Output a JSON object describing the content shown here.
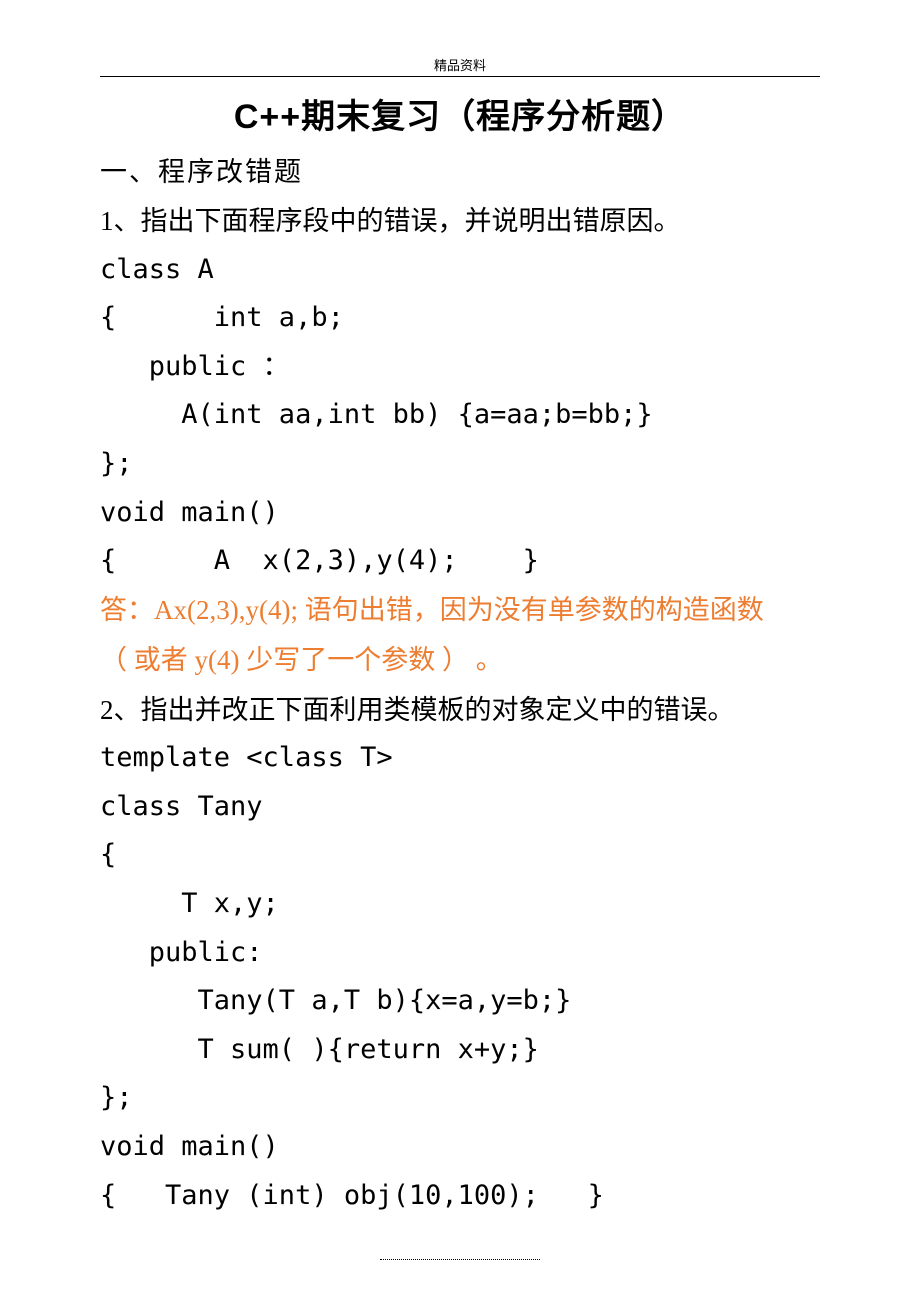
{
  "header": {
    "label": "精品资料"
  },
  "title": "C++期末复习（程序分析题）",
  "sectionHeading": "一、程序改错题",
  "q1": {
    "prompt": "1、指出下面程序段中的错误，并说明出错原因。",
    "code": {
      "l1": "class A",
      "l2": "{      int a,b;",
      "l3": "   public ：",
      "l4": "     A(int aa,int bb) {a=aa;b=bb;}",
      "l5": "};",
      "l6": "void main()",
      "l7": "{      A  x(2,3),y(4);    }"
    },
    "answer": {
      "l1": "答：Ax(2,3),y(4); 语句出错，因为没有单参数的构造函数",
      "l2": "（ 或者 y(4) 少写了一个参数 ） 。"
    }
  },
  "q2": {
    "prompt": "2、指出并改正下面利用类模板的对象定义中的错误。",
    "code": {
      "l1": "template <class T>",
      "l2": "class Tany",
      "l3": "{",
      "l4": "     T x,y;",
      "l5": "   public:",
      "l6": "      Tany(T a,T b){x=a,y=b;}",
      "l7": "      T sum( ){return x+y;}",
      "l8": "};",
      "l9": "void main()",
      "l10": "{   Tany (int) obj(10,100);   }"
    }
  }
}
